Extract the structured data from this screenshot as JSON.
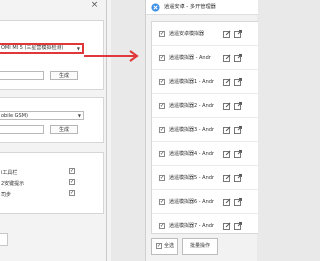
{
  "left_panel": {
    "close_glyph": "×",
    "model_combo": {
      "value": "OMI MI 5 (三星营模拟检测)"
    },
    "generate_button_1": "生成",
    "carrier_combo": {
      "value": "obile GSM)"
    },
    "generate_button_2": "生成",
    "options": [
      {
        "label": "i工具栏",
        "checked": true
      },
      {
        "label": "2安键提示",
        "checked": true
      },
      {
        "label": "司步",
        "checked": true
      }
    ]
  },
  "window": {
    "title": "逍遥安卓 - 多开管理器",
    "instances": [
      {
        "name": "逍遥安卓模拟器",
        "checked": true
      },
      {
        "name": "逍遥模拟器 - Andr",
        "checked": true
      },
      {
        "name": "逍遥模拟器1 - Andr",
        "checked": true
      },
      {
        "name": "逍遥模拟器2 - Andr",
        "checked": true
      },
      {
        "name": "逍遥模拟器3 - Andr",
        "checked": true
      },
      {
        "name": "逍遥模拟器4 - Andr",
        "checked": true
      },
      {
        "name": "逍遥模拟器5 - Andr",
        "checked": true
      },
      {
        "name": "逍遥模拟器6 - Andr",
        "checked": true
      },
      {
        "name": "逍遥模拟器7 - Andr",
        "checked": true
      }
    ],
    "select_all_label": "全选",
    "batch_button": "批量操作",
    "check_glyph": "✓"
  },
  "colors": {
    "accent_red": "#e0383a",
    "logo_blue": "#3a8ee6"
  },
  "icons": [
    "app-logo-icon",
    "edit-icon",
    "open-external-icon",
    "dropdown-arrow-icon",
    "close-icon",
    "arrow-right-icon"
  ]
}
